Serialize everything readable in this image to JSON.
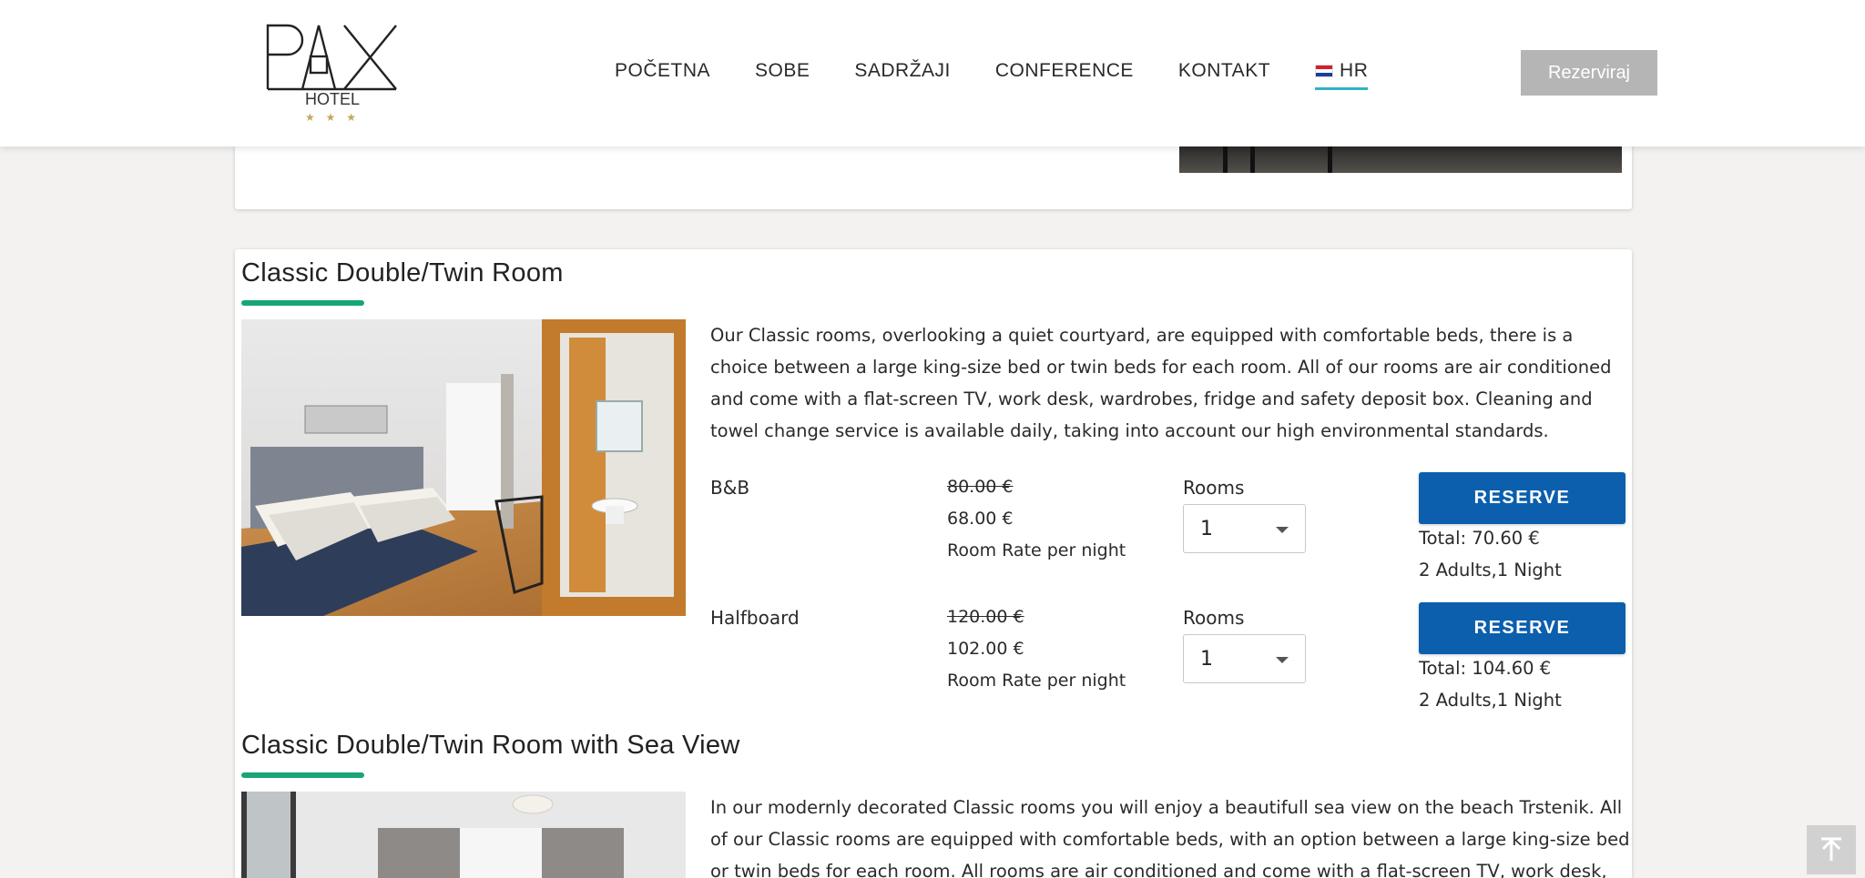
{
  "brand": {
    "logo_text": "HOTEL",
    "logo_word": "PAX",
    "stars": "★ ★ ★",
    "accent": "#17a673",
    "button_color": "#0b5fad"
  },
  "nav": {
    "items": [
      "POČETNA",
      "SOBE",
      "SADRŽAJI",
      "CONFERENCE",
      "KONTAKT"
    ],
    "lang": "HR",
    "reserve": "Rezerviraj"
  },
  "rooms": [
    {
      "title": "Classic Double/Twin Room",
      "description": "Our Classic rooms, overlooking a quiet courtyard, are equipped with comfortable beds, there is a choice between a large king-size bed or twin beds for each room. All of our rooms are air conditioned and come with a flat-screen TV, work desk, wardrobes, fridge and safety deposit box. Cleaning and towel change service is available daily, taking into account our high environmental standards.",
      "rates": [
        {
          "name": "B&B",
          "old_price": "80.00 €",
          "new_price": "68.00 €",
          "note": "Room Rate per night",
          "rooms_label": "Rooms",
          "rooms_value": "1",
          "button": "RESERVE",
          "total": "Total: 70.60 €",
          "guests": "2 Adults,1 Night"
        },
        {
          "name": "Halfboard",
          "old_price": "120.00 €",
          "new_price": "102.00 €",
          "note": "Room Rate per night",
          "rooms_label": "Rooms",
          "rooms_value": "1",
          "button": "RESERVE",
          "total": "Total: 104.60 €",
          "guests": "2 Adults,1 Night"
        }
      ]
    },
    {
      "title": "Classic Double/Twin Room with Sea View",
      "description": "In our modernly decorated Classic rooms you will enjoy a beautifull sea view on the beach Trstenik. All of our Classic rooms are equipped with comfortable beds, with an option between a large king-size bed or twin beds for each room. All rooms are air conditioned and come with a flat-screen TV, work desk,"
    }
  ],
  "icons": {
    "scroll_top": "arrow-up-icon",
    "dropdown": "caret-down-icon",
    "flag": "croatian-flag-icon"
  }
}
